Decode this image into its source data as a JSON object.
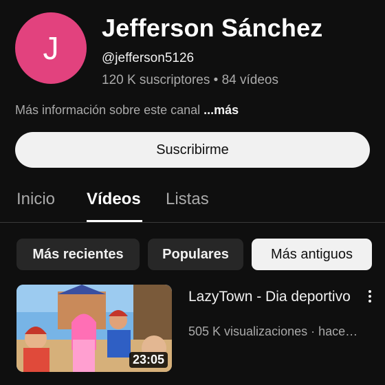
{
  "channel": {
    "avatar_letter": "J",
    "avatar_color": "#e2427e",
    "name": "Jefferson Sánchez",
    "handle": "@jefferson5126",
    "stats": "120 K suscriptores • 84 vídeos",
    "more_info_text": "Más información sobre este canal ",
    "more_link": "...más",
    "subscribe_label": "Suscribirme"
  },
  "tabs": [
    {
      "label": "Inicio",
      "active": false
    },
    {
      "label": "Vídeos",
      "active": true
    },
    {
      "label": "Listas",
      "active": false
    }
  ],
  "chips": [
    {
      "label": "Más recientes",
      "selected": false
    },
    {
      "label": "Populares",
      "selected": false
    },
    {
      "label": "Más antiguos",
      "selected": true
    }
  ],
  "videos": [
    {
      "title": "LazyTown - Dia deportivo",
      "meta": "505 K visualizaciones · hace…",
      "duration": "23:05",
      "menu_icon": "more-vert-icon"
    }
  ]
}
